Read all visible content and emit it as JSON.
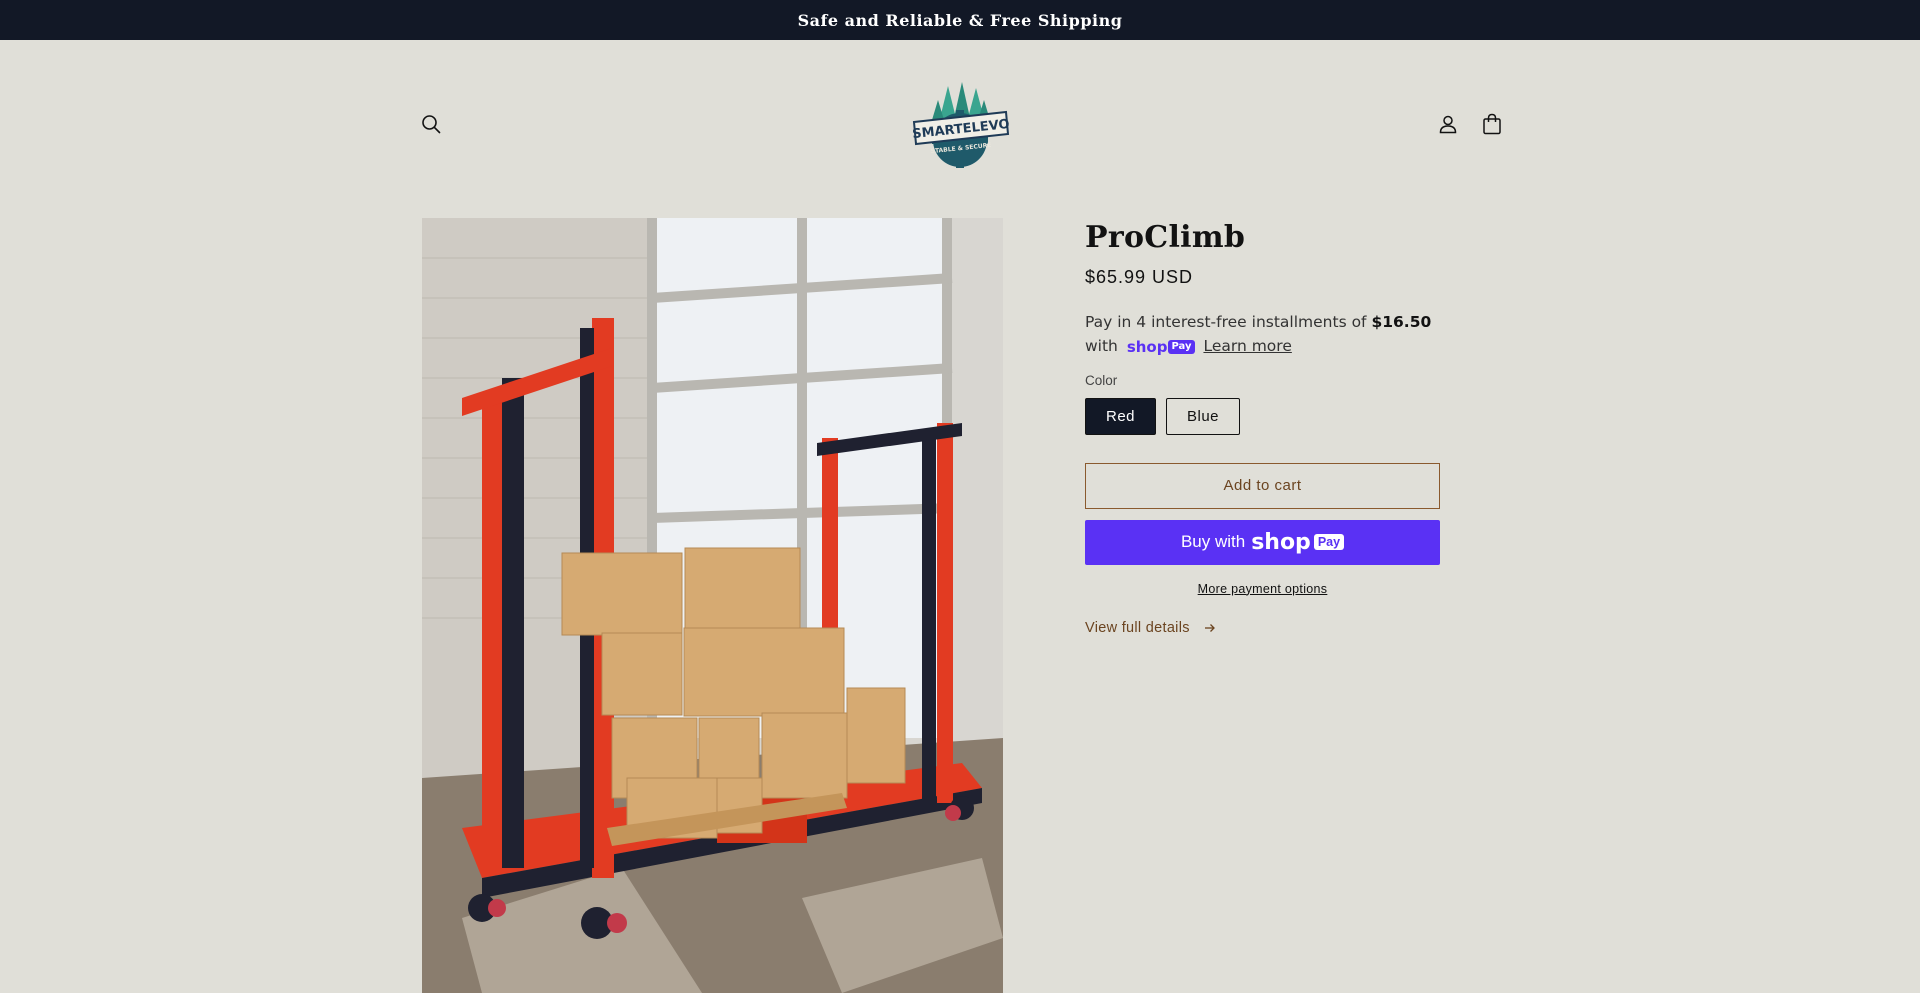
{
  "announcement": {
    "text": "Safe and Reliable & Free Shipping"
  },
  "header": {
    "logo": {
      "brand": "SMARTELEVO",
      "tagline": "STABLE & SECURE"
    },
    "icons": {
      "search": "search-icon",
      "account": "user-icon",
      "cart": "bag-icon"
    }
  },
  "product": {
    "title": "ProClimb",
    "price": "$65.99 USD",
    "installments": {
      "prefix": "Pay in 4 interest-free installments of ",
      "amount": "$16.50",
      "with": "with",
      "shop": "shop",
      "pay": "Pay",
      "learn_more": "Learn more"
    },
    "color_label": "Color",
    "colors": [
      "Red",
      "Blue"
    ],
    "selected_color": "Red",
    "add_to_cart": "Add to cart",
    "buy_now": {
      "label": "Buy with",
      "shop": "shop",
      "pay": "Pay"
    },
    "more_payment_options": "More payment options",
    "view_full_details": "View full details",
    "view_details_icon": "arrow-right-icon"
  },
  "colors": {
    "announcement_bg": "#121826",
    "page_bg": "#e0dfd8",
    "shop_pay": "#5a31f4",
    "accent": "#6b4420",
    "logo_teal": "#2a8a7a",
    "logo_navy": "#1f3b57"
  }
}
